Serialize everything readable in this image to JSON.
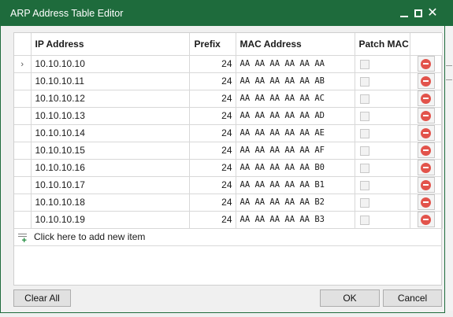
{
  "dialog": {
    "title": "ARP Address Table Editor"
  },
  "columns": {
    "ip": "IP Address",
    "prefix": "Prefix",
    "mac": "MAC Address",
    "patch": "Patch MAC"
  },
  "rows": [
    {
      "ip": "10.10.10.10",
      "prefix": "24",
      "mac": "AA AA AA AA AA AA"
    },
    {
      "ip": "10.10.10.11",
      "prefix": "24",
      "mac": "AA AA AA AA AA AB"
    },
    {
      "ip": "10.10.10.12",
      "prefix": "24",
      "mac": "AA AA AA AA AA AC"
    },
    {
      "ip": "10.10.10.13",
      "prefix": "24",
      "mac": "AA AA AA AA AA AD"
    },
    {
      "ip": "10.10.10.14",
      "prefix": "24",
      "mac": "AA AA AA AA AA AE"
    },
    {
      "ip": "10.10.10.15",
      "prefix": "24",
      "mac": "AA AA AA AA AA AF"
    },
    {
      "ip": "10.10.10.16",
      "prefix": "24",
      "mac": "AA AA AA AA AA B0"
    },
    {
      "ip": "10.10.10.17",
      "prefix": "24",
      "mac": "AA AA AA AA AA B1"
    },
    {
      "ip": "10.10.10.18",
      "prefix": "24",
      "mac": "AA AA AA AA AA B2"
    },
    {
      "ip": "10.10.10.19",
      "prefix": "24",
      "mac": "AA AA AA AA AA B3"
    }
  ],
  "add_item_label": "Click here to add new item",
  "buttons": {
    "clear_all": "Clear All",
    "ok": "OK",
    "cancel": "Cancel"
  },
  "colors": {
    "titlebar": "#1e6b3c",
    "delete_icon": "#e2534b",
    "add_plus": "#1e8a3c"
  }
}
